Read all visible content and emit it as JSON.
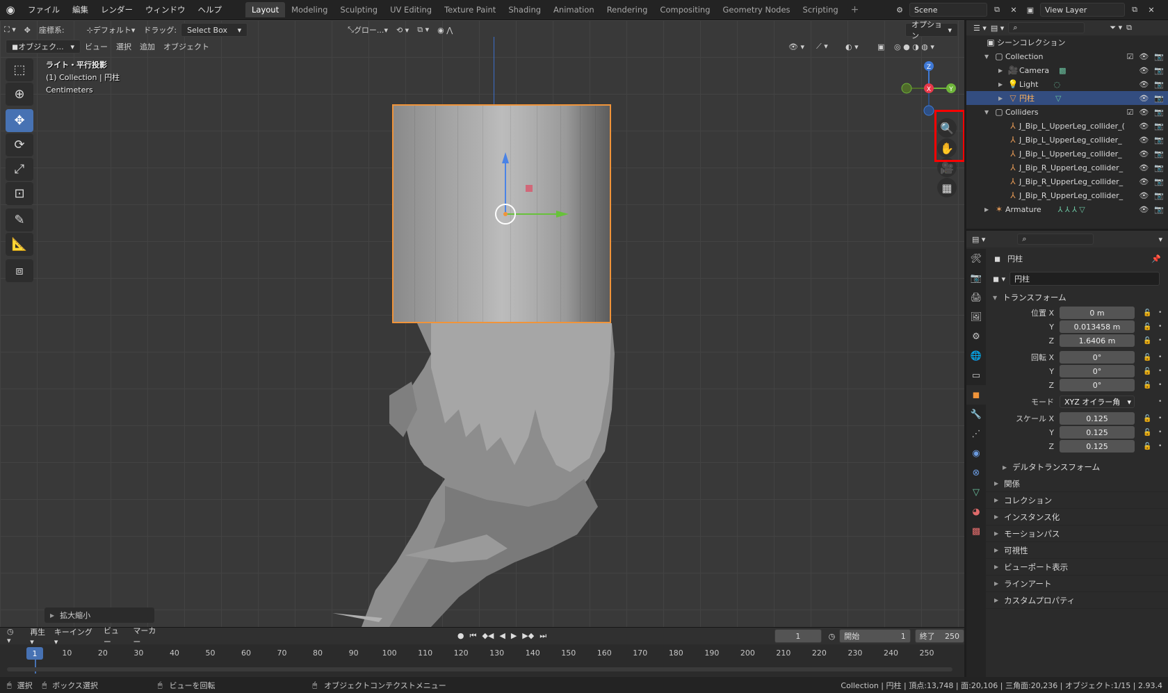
{
  "menu": {
    "file": "ファイル",
    "edit": "編集",
    "render": "レンダー",
    "window": "ウィンドウ",
    "help": "ヘルプ"
  },
  "workspaces": [
    "Layout",
    "Modeling",
    "Sculpting",
    "UV Editing",
    "Texture Paint",
    "Shading",
    "Animation",
    "Rendering",
    "Compositing",
    "Geometry Nodes",
    "Scripting"
  ],
  "scene": {
    "name": "Scene",
    "view_layer": "View Layer"
  },
  "viewport_header": {
    "coord_label": "座標系:",
    "coord_value": "デフォルト",
    "drag_label": "ドラッグ:",
    "drag_value": "Select Box",
    "pivot": "グロー...",
    "options": "オプション",
    "mode": "オブジェク...",
    "view": "ビュー",
    "select": "選択",
    "add": "追加",
    "object": "オブジェクト"
  },
  "viewport_info": {
    "line1": "ライト・平行投影",
    "line2": "(1) Collection | 円柱",
    "line3": "Centimeters"
  },
  "last_op": "拡大縮小",
  "timeline": {
    "play": "再生",
    "keying": "キーイング",
    "view": "ビュー",
    "marker": "マーカー",
    "current_frame": "1",
    "start_label": "開始",
    "start": "1",
    "end_label": "終了",
    "end": "250",
    "ticks": [
      "1",
      "10",
      "20",
      "30",
      "40",
      "50",
      "60",
      "70",
      "80",
      "90",
      "100",
      "110",
      "120",
      "130",
      "140",
      "150",
      "160",
      "170",
      "180",
      "190",
      "200",
      "210",
      "220",
      "230",
      "240",
      "250"
    ]
  },
  "status": {
    "select": "選択",
    "box_select": "ボックス選択",
    "rotate_view": "ビューを回転",
    "context_menu": "オブジェクトコンテクストメニュー",
    "stats": "Collection | 円柱 | 頂点:13,748 | 面:20,106 | 三角面:20,236 | オブジェクト:1/15 | 2.93.4"
  },
  "outliner": {
    "root": "シーンコレクション",
    "items": [
      {
        "label": "Collection"
      },
      {
        "label": "Camera"
      },
      {
        "label": "Light"
      },
      {
        "label": "円柱"
      },
      {
        "label": "Colliders"
      },
      {
        "label": "J_Bip_L_UpperLeg_collider_("
      },
      {
        "label": "J_Bip_L_UpperLeg_collider_"
      },
      {
        "label": "J_Bip_L_UpperLeg_collider_"
      },
      {
        "label": "J_Bip_R_UpperLeg_collider_"
      },
      {
        "label": "J_Bip_R_UpperLeg_collider_"
      },
      {
        "label": "J_Bip_R_UpperLeg_collider_"
      },
      {
        "label": "Armature"
      }
    ]
  },
  "properties": {
    "object_name": "円柱",
    "name_field": "円柱",
    "transform": "トランスフォーム",
    "loc_label_x": "位置 X",
    "y": "Y",
    "z": "Z",
    "loc_x": "0 m",
    "loc_y": "0.013458 m",
    "loc_z": "1.6406 m",
    "rot_label_x": "回転 X",
    "rot_x": "0°",
    "rot_y": "0°",
    "rot_z": "0°",
    "mode_label": "モード",
    "mode_value": "XYZ オイラー角",
    "scale_label_x": "スケール X",
    "scale_x": "0.125",
    "scale_y": "0.125",
    "scale_z": "0.125",
    "delta": "デルタトランスフォーム",
    "sections": [
      "関係",
      "コレクション",
      "インスタンス化",
      "モーションパス",
      "可視性",
      "ビューポート表示",
      "ラインアート",
      "カスタムプロパティ"
    ]
  },
  "colors": {
    "accent": "#4772b3",
    "selection_outline": "#f0943a",
    "highlight": "#ff0000"
  }
}
